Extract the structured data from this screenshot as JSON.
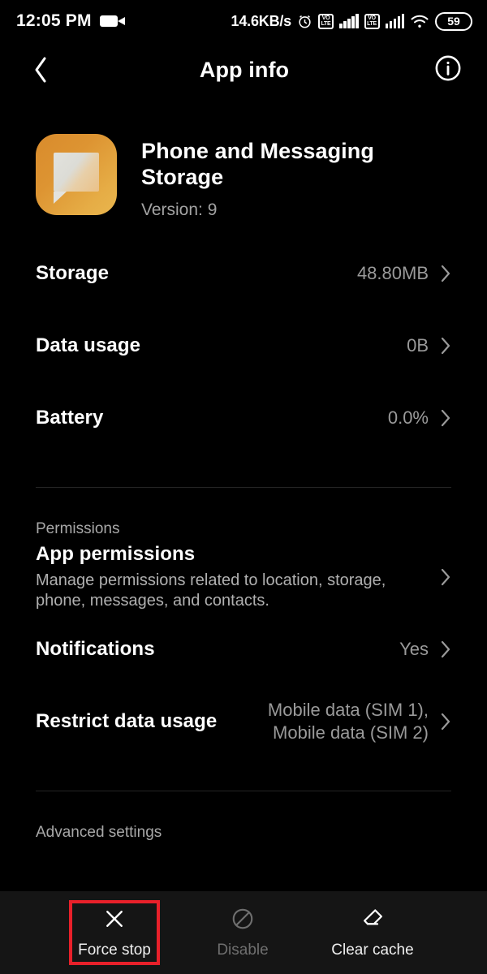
{
  "status_bar": {
    "time": "12:05 PM",
    "recording_icon": "videocam-icon",
    "network_speed": "14.6KB/s",
    "alarm_icon": "alarm-clock-icon",
    "sim1_volte_top": "VO",
    "sim1_volte_bottom": "LTE",
    "sim2_volte_top": "VO",
    "sim2_volte_bottom": "LTE",
    "wifi_icon": "wifi-icon",
    "battery_level": "59"
  },
  "app_bar": {
    "back_icon": "chevron-left-icon",
    "title": "App info",
    "info_icon": "info-circle-icon"
  },
  "app_header": {
    "icon_name": "phone-and-messaging-storage-app-icon",
    "icon_color": "#e0a03c",
    "name": "Phone and Messaging Storage",
    "version": "Version: 9"
  },
  "usage_rows": [
    {
      "title": "Storage",
      "value": "48.80MB"
    },
    {
      "title": "Data usage",
      "value": "0B"
    },
    {
      "title": "Battery",
      "value": "0.0%"
    }
  ],
  "permissions_section": {
    "label": "Permissions",
    "app_permissions": {
      "title": "App permissions",
      "subtitle": "Manage permissions related to location, storage, phone, messages, and contacts."
    },
    "notifications": {
      "title": "Notifications",
      "value": "Yes"
    },
    "restrict_data_usage": {
      "title": "Restrict data usage",
      "value": "Mobile data (SIM 1),\nMobile data (SIM 2)"
    }
  },
  "advanced_section": {
    "label": "Advanced settings"
  },
  "bottom_bar": {
    "highlight_color": "#e8202a",
    "actions": [
      {
        "label": "Force stop",
        "icon": "close-x-icon",
        "state": "highlighted"
      },
      {
        "label": "Disable",
        "icon": "block-circle-icon",
        "state": "disabled"
      },
      {
        "label": "Clear cache",
        "icon": "eraser-icon",
        "state": "enabled"
      }
    ]
  }
}
